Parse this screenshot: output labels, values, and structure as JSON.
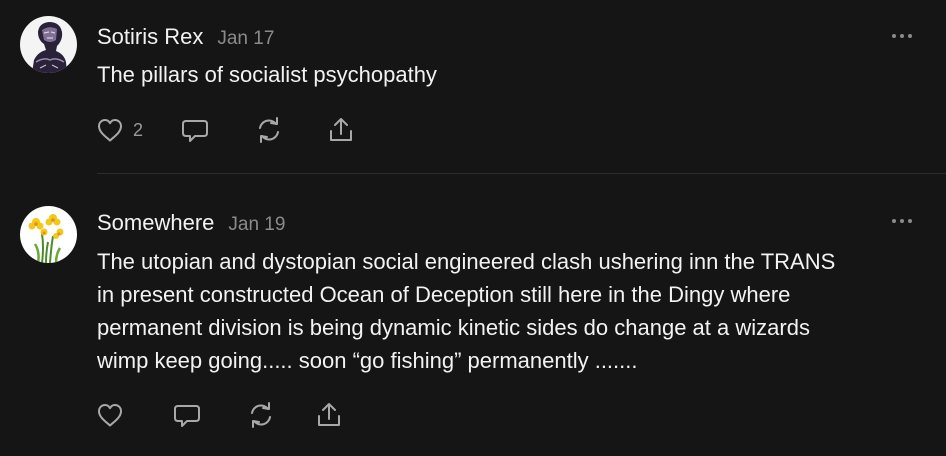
{
  "comments": [
    {
      "author": "Sotiris Rex",
      "date": "Jan 17",
      "lines": [
        "The pillars of socialist psychopathy"
      ],
      "likes": "2",
      "avatar_icon": "engraved-portrait-avatar"
    },
    {
      "author": "Somewhere",
      "date": "Jan 19",
      "lines": [
        "The utopian and dystopian social engineered clash ushering inn the TRANS",
        "in present constructed Ocean of Deception still here in the Dingy where",
        "permanent division is being dynamic kinetic sides do change at a wizards",
        "wimp keep going..... soon “go fishing” permanently ......."
      ],
      "likes": "",
      "avatar_icon": "daffodil-avatar"
    }
  ],
  "icons": {
    "like": "heart-icon",
    "reply": "speech-bubble-icon",
    "restack": "restack-arrows-icon",
    "share": "share-upload-icon",
    "more": "more-dots-icon"
  },
  "colors": {
    "background": "#151515",
    "text": "#f2f2f2",
    "muted": "#8b8b8b",
    "icon": "#a8a8a8",
    "divider": "#2c2c2c"
  }
}
